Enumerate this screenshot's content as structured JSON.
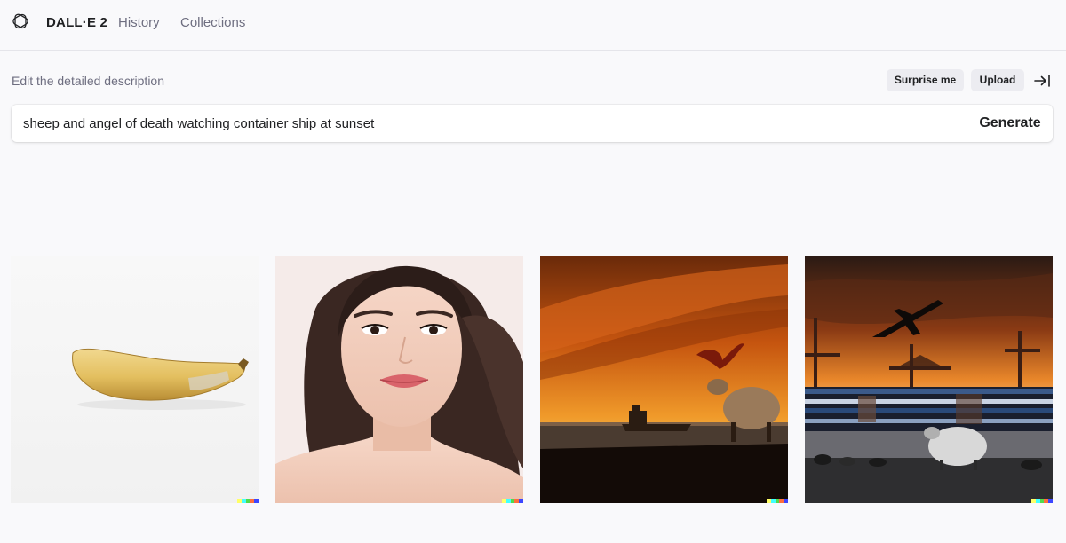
{
  "header": {
    "brand": "DALL·E 2",
    "nav": [
      "History",
      "Collections"
    ],
    "logo_icon": "openai-logo-icon"
  },
  "editor": {
    "description_label": "Edit the detailed description",
    "surprise_label": "Surprise me",
    "upload_label": "Upload",
    "collapse_icon": "arrow-right-to-bar-icon",
    "prompt_value": "sheep and angel of death watching container ship at sunset",
    "generate_label": "Generate"
  },
  "images": [
    {
      "subject": "banana"
    },
    {
      "subject": "portrait-woman"
    },
    {
      "subject": "sheep-bird-sunset-ship"
    },
    {
      "subject": "sheep-plane-container-port"
    }
  ],
  "colors": {
    "background": "#f9f9fb",
    "pill": "#ececf1",
    "text": "#202123",
    "muted": "#6e6e80",
    "signature": [
      "#ffff66",
      "#42ffff",
      "#51da4c",
      "#ff6e3c",
      "#3c46ff"
    ]
  }
}
